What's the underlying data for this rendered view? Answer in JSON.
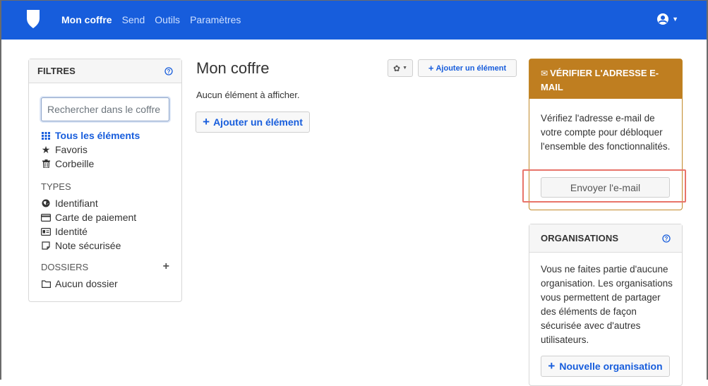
{
  "navbar": {
    "items": [
      {
        "label": "Mon coffre"
      },
      {
        "label": "Send"
      },
      {
        "label": "Outils"
      },
      {
        "label": "Paramètres"
      }
    ]
  },
  "filters": {
    "title": "FILTRES",
    "search_placeholder": "Rechercher dans le coffre",
    "all_items": "Tous les éléments",
    "favorites": "Favoris",
    "trash": "Corbeille",
    "types_label": "TYPES",
    "types": [
      {
        "label": "Identifiant",
        "icon": "globe-icon"
      },
      {
        "label": "Carte de paiement",
        "icon": "credit-card-icon"
      },
      {
        "label": "Identité",
        "icon": "id-card-icon"
      },
      {
        "label": "Note sécurisée",
        "icon": "sticky-note-icon"
      }
    ],
    "folders_label": "DOSSIERS",
    "no_folder": "Aucun dossier"
  },
  "main": {
    "title": "Mon coffre",
    "toolbar_add": "Ajouter un élément",
    "empty_text": "Aucun élément à afficher.",
    "center_add": "Ajouter un élément"
  },
  "verify": {
    "title": "VÉRIFIER L'ADRESSE E-MAIL",
    "body": "Vérifiez l'adresse e-mail de votre compte pour débloquer l'ensemble des fonctionnalités.",
    "button": "Envoyer l'e-mail"
  },
  "organisations": {
    "title": "ORGANISATIONS",
    "body": "Vous ne faites partie d'aucune organisation. Les organisations vous permettent de partager des éléments de façon sécurisée avec d'autres utilisateurs.",
    "button": "Nouvelle organisation"
  },
  "colors": {
    "brand": "#175ddc",
    "warning": "#bf7e20",
    "highlight": "#e8746a"
  }
}
